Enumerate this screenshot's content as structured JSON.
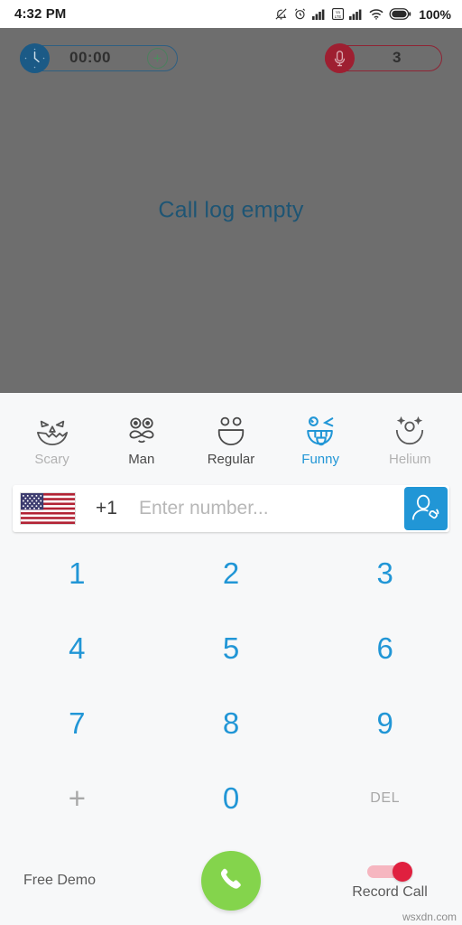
{
  "status_bar": {
    "time": "4:32 PM",
    "battery_percent": "100%",
    "icons": [
      "bell-muted-icon",
      "alarm-clock-icon",
      "signal-bars-icon",
      "volte-icon",
      "signal-bars-2-icon",
      "wifi-icon",
      "battery-icon"
    ]
  },
  "call_log": {
    "empty_message": "Call log empty",
    "timer": {
      "value": "00:00",
      "add_label": "+",
      "badge_icon": "clock-icon"
    },
    "credits": {
      "value": "3",
      "badge_icon": "microphone-icon"
    }
  },
  "effects": {
    "items": [
      {
        "label": "Scary",
        "icon": "scary-face-icon",
        "state": "dim"
      },
      {
        "label": "Man",
        "icon": "mustache-face-icon",
        "state": "normal"
      },
      {
        "label": "Regular",
        "icon": "smile-face-icon",
        "state": "normal"
      },
      {
        "label": "Funny",
        "icon": "tongue-face-icon",
        "state": "selected"
      },
      {
        "label": "Helium",
        "icon": "sparkle-face-icon",
        "state": "dim"
      }
    ]
  },
  "number_input": {
    "flag": "us-flag-icon",
    "country_code": "+1",
    "value": "",
    "placeholder": "Enter number...",
    "contacts_icon": "contact-call-icon"
  },
  "dialpad": {
    "keys": [
      {
        "label": "1",
        "style": "number"
      },
      {
        "label": "2",
        "style": "number"
      },
      {
        "label": "3",
        "style": "number"
      },
      {
        "label": "4",
        "style": "number"
      },
      {
        "label": "5",
        "style": "number"
      },
      {
        "label": "6",
        "style": "number"
      },
      {
        "label": "7",
        "style": "number"
      },
      {
        "label": "8",
        "style": "number"
      },
      {
        "label": "9",
        "style": "number"
      },
      {
        "label": "+",
        "style": "muted"
      },
      {
        "label": "0",
        "style": "number"
      },
      {
        "label": "DEL",
        "style": "del"
      }
    ]
  },
  "bottom_bar": {
    "demo_label": "Free Demo",
    "call_icon": "phone-handset-icon",
    "record_label": "Record Call",
    "record_on": true
  },
  "watermark": "wsxdn.com",
  "colors": {
    "accent_blue": "#2196d6",
    "call_green": "#84d44c",
    "record_red": "#e0203f",
    "log_bg": "#6e6e6e",
    "empty_text": "#1e5574"
  }
}
